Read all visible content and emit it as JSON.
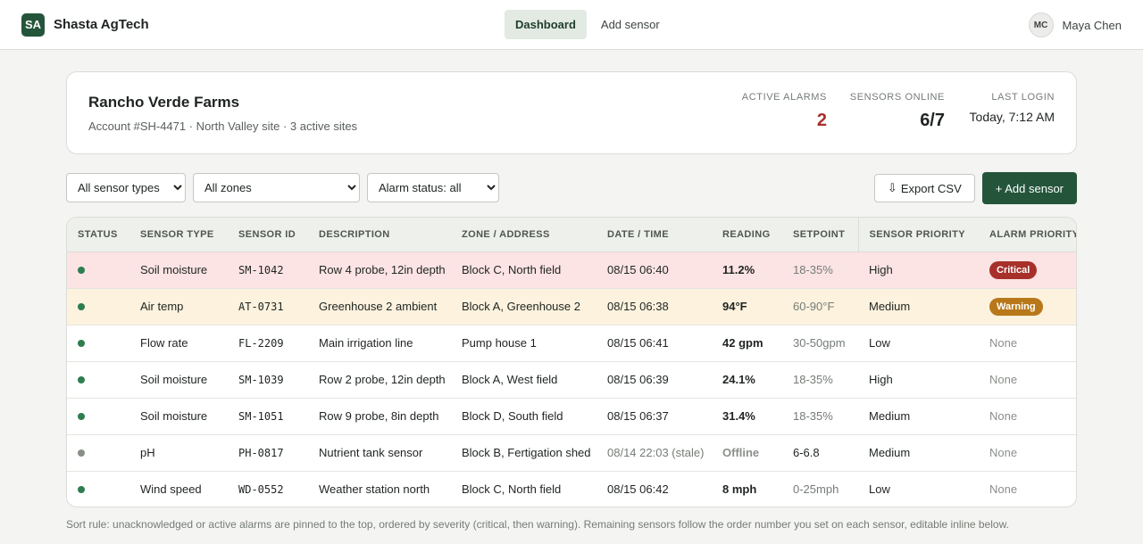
{
  "app": {
    "logo_text": "SA",
    "name": "Shasta AgTech"
  },
  "nav": [
    {
      "label": "Dashboard",
      "active": true
    },
    {
      "label": "Add sensor",
      "active": false
    }
  ],
  "user": {
    "initials": "MC",
    "name": "Maya Chen"
  },
  "account": {
    "name": "Rancho Verde Farms",
    "meta": "Account #SH-4471 · North Valley site · 3 active sites",
    "stats": {
      "active_alarms": {
        "label": "ACTIVE ALARMS",
        "value": "2"
      },
      "sensors_online": {
        "label": "SENSORS ONLINE",
        "value": "6/7"
      },
      "last_login": {
        "label": "LAST LOGIN",
        "value": "Today, 7:12 AM"
      }
    }
  },
  "filters": {
    "sensor_types": {
      "selected": "All sensor types"
    },
    "zones": {
      "selected": "All zones"
    },
    "alarm_status": {
      "selected": "Alarm status: all"
    }
  },
  "actions": {
    "export_icon": "⇩",
    "export_label": "Export CSV",
    "add_label": "+ Add sensor"
  },
  "table": {
    "headers": [
      "STATUS",
      "SENSOR TYPE",
      "SENSOR ID",
      "DESCRIPTION",
      "ZONE / ADDRESS",
      "DATE / TIME",
      "READING",
      "SETPOINT",
      "SENSOR PRIORITY",
      "ALARM PRIORITY"
    ],
    "rows": [
      {
        "status_color": "#2e7d4f",
        "type": "Soil moisture",
        "id": "SM-1042",
        "description": "Row 4 probe, 12in depth",
        "zone": "Block C, North field",
        "datetime": "08/15 06:40",
        "reading": "11.2%",
        "setpoint": "18-35%",
        "sensor_priority": "High",
        "alarm_priority": "Critical",
        "alarm_level": "critical"
      },
      {
        "status_color": "#2e7d4f",
        "type": "Air temp",
        "id": "AT-0731",
        "description": "Greenhouse 2 ambient",
        "zone": "Block A, Greenhouse 2",
        "datetime": "08/15 06:38",
        "reading": "94°F",
        "setpoint": "60-90°F",
        "sensor_priority": "Medium",
        "alarm_priority": "Warning",
        "alarm_level": "warning"
      },
      {
        "status_color": "#2e7d4f",
        "type": "Flow rate",
        "id": "FL-2209",
        "description": "Main irrigation line",
        "zone": "Pump house 1",
        "datetime": "08/15 06:41",
        "reading": "42 gpm",
        "setpoint": "30-50gpm",
        "sensor_priority": "Low",
        "alarm_priority": "None",
        "alarm_level": "none"
      },
      {
        "status_color": "#2e7d4f",
        "type": "Soil moisture",
        "id": "SM-1039",
        "description": "Row 2 probe, 12in depth",
        "zone": "Block A, West field",
        "datetime": "08/15 06:39",
        "reading": "24.1%",
        "setpoint": "18-35%",
        "sensor_priority": "High",
        "alarm_priority": "None",
        "alarm_level": "none"
      },
      {
        "status_color": "#2e7d4f",
        "type": "Soil moisture",
        "id": "SM-1051",
        "description": "Row 9 probe, 8in depth",
        "zone": "Block D, South field",
        "datetime": "08/15 06:37",
        "reading": "31.4%",
        "setpoint": "18-35%",
        "sensor_priority": "Medium",
        "alarm_priority": "None",
        "alarm_level": "none"
      },
      {
        "status_color": "#8a8f85",
        "type": "pH",
        "id": "PH-0817",
        "description": "Nutrient tank sensor",
        "zone": "Block B, Fertigation shed",
        "datetime": "08/14 22:03 (stale)",
        "reading": "Offline",
        "setpoint": "6-6.8",
        "sensor_priority": "Medium",
        "alarm_priority": "None",
        "alarm_level": "none"
      },
      {
        "status_color": "#2e7d4f",
        "type": "Wind speed",
        "id": "WD-0552",
        "description": "Weather station north",
        "zone": "Block C, North field",
        "datetime": "08/15 06:42",
        "reading": "8 mph",
        "setpoint": "0-25mph",
        "sensor_priority": "Low",
        "alarm_priority": "None",
        "alarm_level": "none"
      }
    ]
  },
  "footnote": "Sort rule: unacknowledged or active alarms are pinned to the top, ordered by severity (critical, then warning). Remaining sensors follow the order number you set on each sensor, editable inline below."
}
